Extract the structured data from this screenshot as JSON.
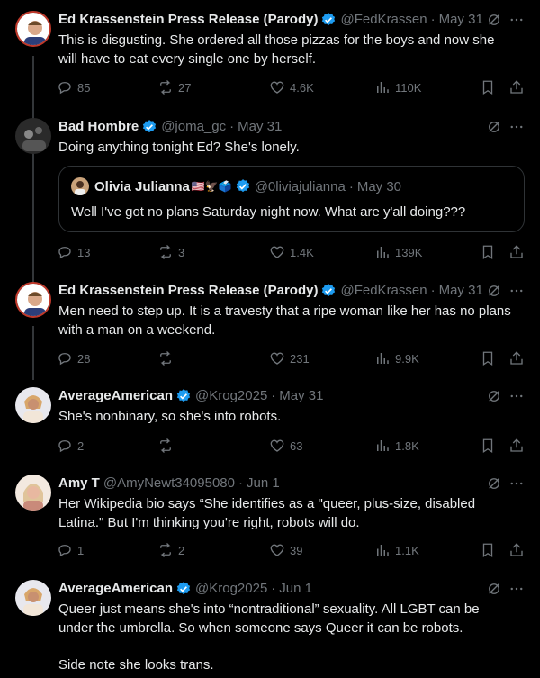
{
  "colors": {
    "background": "#000000",
    "text": "#e7e9ea",
    "muted": "#71767b",
    "verified": "#1d9bf0",
    "divider": "#2f3336"
  },
  "posts": [
    {
      "name": "Ed Krassenstein Press Release (Parody)",
      "handle": "@FedKrassen",
      "time": "May 31",
      "text": "This is disgusting. She ordered all those pizzas for the boys and now she will have to eat every single one by herself.",
      "replies": "85",
      "reposts": "27",
      "likes": "4.6K",
      "views": "110K"
    },
    {
      "name": "Bad Hombre",
      "handle": "@joma_gc",
      "time": "May 31",
      "text": "Doing anything tonight Ed? She's lonely.",
      "quote": {
        "name": "Olivia Julianna",
        "emoji": "🇺🇸🦅🗳️",
        "handle": "@0liviajulianna",
        "time": "May 30",
        "text": "Well I've got no plans Saturday night now. What are y'all doing???"
      },
      "replies": "13",
      "reposts": "3",
      "likes": "1.4K",
      "views": "139K"
    },
    {
      "name": "Ed Krassenstein Press Release (Parody)",
      "handle": "@FedKrassen",
      "time": "May 31",
      "text": "Men need to step up. It is a travesty that a ripe woman like her has no plans with a man on a weekend.",
      "replies": "28",
      "reposts": "",
      "likes": "231",
      "views": "9.9K"
    },
    {
      "name": "AverageAmerican",
      "handle": "@Krog2025",
      "time": "May 31",
      "text": "She's nonbinary, so she's into robots.",
      "replies": "2",
      "reposts": "",
      "likes": "63",
      "views": "1.8K"
    },
    {
      "name": "Amy T",
      "handle": "@AmyNewt34095080",
      "time": "Jun 1",
      "text": "Her Wikipedia bio says “She identifies as a \"queer, plus-size, disabled Latina.\" But I'm thinking you're right, robots will do.",
      "replies": "1",
      "reposts": "2",
      "likes": "39",
      "views": "1.1K"
    },
    {
      "name": "AverageAmerican",
      "handle": "@Krog2025",
      "time": "Jun 1",
      "text": "Queer just means she's into “nontraditional” sexuality. All LGBT can be under the umbrella. So when someone says Queer it can be robots.\n\nSide note she looks trans."
    }
  ]
}
